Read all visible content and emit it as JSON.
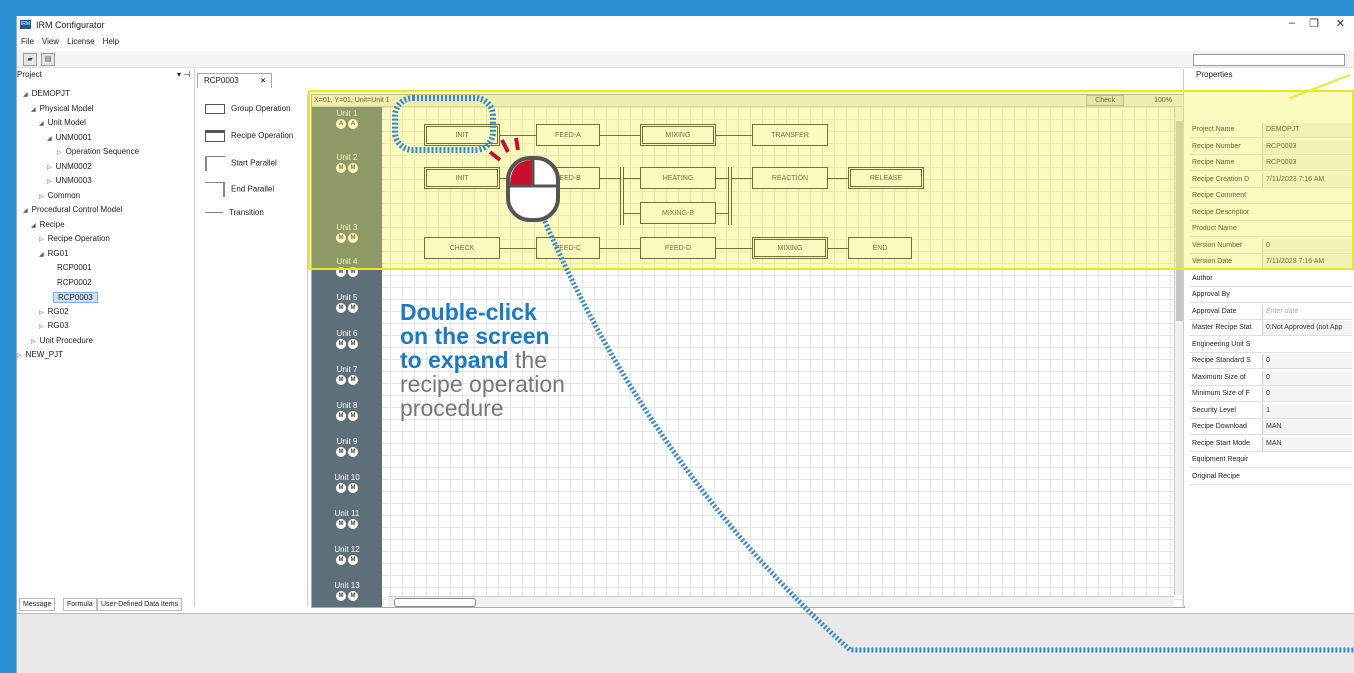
{
  "window": {
    "title": "IRM Configurator",
    "icon_text": "IRM",
    "minimize": "–",
    "maximize": "❐",
    "close": "✕"
  },
  "menu": [
    "File",
    "View",
    "License",
    "Help"
  ],
  "toolbar": {
    "open_icon": "folder-open-icon",
    "save_icon": "save-icon"
  },
  "project_pane": {
    "title": "Project",
    "pin": "▾ ⊣",
    "tree": [
      {
        "label": "DEMOPJT",
        "arrow": "◢"
      },
      {
        "label": "Physical Model",
        "arrow": "◢"
      },
      {
        "label": "Unit Model",
        "arrow": "◢"
      },
      {
        "label": "UNM0001",
        "arrow": "◢"
      },
      {
        "label": "Operation Sequence",
        "arrow": "▷"
      },
      {
        "label": "UNM0002",
        "arrow": "▷"
      },
      {
        "label": "UNM0003",
        "arrow": "▷"
      },
      {
        "label": "Common",
        "arrow": "▷"
      },
      {
        "label": "Procedural Control Model",
        "arrow": "◢"
      },
      {
        "label": "Recipe",
        "arrow": "◢"
      },
      {
        "label": "Recipe Operation",
        "arrow": "▷"
      },
      {
        "label": "RG01",
        "arrow": "◢"
      },
      {
        "label": "RCP0001",
        "arrow": ""
      },
      {
        "label": "RCP0002",
        "arrow": ""
      },
      {
        "label": "RCP0003",
        "arrow": ""
      },
      {
        "label": "RG02",
        "arrow": "▷"
      },
      {
        "label": "RG03",
        "arrow": "▷"
      },
      {
        "label": "Unit Procedure",
        "arrow": "▷"
      },
      {
        "label": "NEW_PJT",
        "arrow": "▷"
      }
    ]
  },
  "doc_tab": {
    "label": "RCP0003",
    "close": "×"
  },
  "palette": [
    "Group Operation",
    "Recipe Operation",
    "Start Parallel",
    "End Parallel",
    "Transition"
  ],
  "editor": {
    "coords": "X=01, Y=01, Unit=Unit 1",
    "check": "Check",
    "zoom": "100%",
    "units": [
      {
        "label": "Unit 1",
        "badges": [
          "A",
          "A"
        ]
      },
      {
        "label": "Unit 2",
        "badges": [
          "M",
          "M"
        ]
      },
      {
        "label": "Unit 3",
        "badges": [
          "M",
          "M"
        ]
      },
      {
        "label": "Unit 4",
        "badges": [
          "M",
          "M"
        ]
      },
      {
        "label": "Unit 5",
        "badges": [
          "M",
          "M"
        ]
      },
      {
        "label": "Unit 6",
        "badges": [
          "M",
          "M"
        ]
      },
      {
        "label": "Unit 7",
        "badges": [
          "M",
          "M"
        ]
      },
      {
        "label": "Unit 8",
        "badges": [
          "M",
          "M"
        ]
      },
      {
        "label": "Unit 9",
        "badges": [
          "M",
          "M"
        ]
      },
      {
        "label": "Unit 10",
        "badges": [
          "M",
          "M"
        ]
      },
      {
        "label": "Unit 11",
        "badges": [
          "M",
          "M"
        ]
      },
      {
        "label": "Unit 12",
        "badges": [
          "M",
          "M"
        ]
      },
      {
        "label": "Unit 13",
        "badges": [
          "M",
          "M"
        ]
      }
    ],
    "ops": {
      "u1_init": "INIT",
      "u1_feed_a": "FEED-A",
      "u1_mixing": "MIXING",
      "u1_transfer": "TRANSFER",
      "u2_init": "INIT",
      "u2_feed_b": "FEED-B",
      "u2_heating": "HEATING",
      "u2_mixing_b": "MIXING-B",
      "u2_reaction": "REACTION",
      "u2_release": "RELEASE",
      "u3_check": "CHECK",
      "u3_feed_c": "FEED-C",
      "u3_feed_d": "FEED-D",
      "u3_mixing": "MIXING",
      "u3_end": "END"
    }
  },
  "properties": {
    "title": "Properties",
    "rows": [
      {
        "name": "Project Name",
        "value": "DEMOPJT"
      },
      {
        "name": "Recipe Number",
        "value": "RCP0003"
      },
      {
        "name": "Recipe Name",
        "value": "RCP0003"
      },
      {
        "name": "Recipe Creation D",
        "value": "7/11/2023 7:16 AM"
      },
      {
        "name": "Recipe Comment",
        "value": ""
      },
      {
        "name": "Recipe Descriptior",
        "value": ""
      },
      {
        "name": "Product Name",
        "value": ""
      },
      {
        "name": "Version Number",
        "value": "0"
      },
      {
        "name": "Version Date",
        "value": "7/11/2023 7:16 AM"
      },
      {
        "name": "Author",
        "value": ""
      },
      {
        "name": "Approval By",
        "value": ""
      },
      {
        "name": "Approval Date",
        "value": "Enter date",
        "placeholder": true
      },
      {
        "name": "Master Recipe Stat",
        "value": "0:Not Approved (not App"
      },
      {
        "name": "Engineering Unit S",
        "value": ""
      },
      {
        "name": "Recipe Standard S",
        "value": "0"
      },
      {
        "name": "Maximum Size of",
        "value": "0"
      },
      {
        "name": "Minimum Size of F",
        "value": "0"
      },
      {
        "name": "Security Level",
        "value": "1"
      },
      {
        "name": "Recipe Download",
        "value": "MAN"
      },
      {
        "name": "Recipe Start Mode",
        "value": "MAN"
      },
      {
        "name": "Equipment Requir",
        "value": ""
      },
      {
        "name": "Original Recipe",
        "value": ""
      }
    ]
  },
  "bottom_tabs": [
    "Message",
    "Formula",
    "User-Defined Data Items"
  ],
  "callout": {
    "line1": "Double-click",
    "line2": "on the screen",
    "line3_bold": "to expand",
    "line3_rest": " the",
    "line4": "recipe operation",
    "line5": "procedure"
  },
  "colors": {
    "background": "#2b8fcf",
    "highlight": "#e8e82a",
    "accent": "#1d79c4",
    "unit_column": "#5f6f7a",
    "mouse_red": "#c8102e"
  }
}
